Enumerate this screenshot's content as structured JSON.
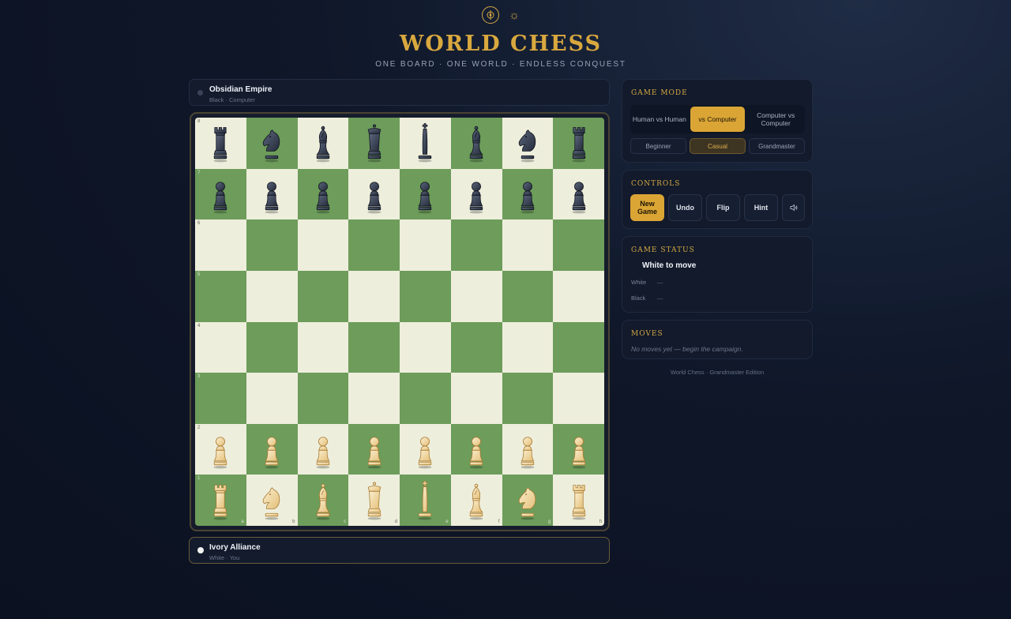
{
  "header": {
    "emblem_icon": "compass-emblem-icon",
    "theme_icon": "sun-icon",
    "title": "WORLD CHESS",
    "subtitle": "ONE BOARD · ONE WORLD · ENDLESS CONQUEST"
  },
  "players": {
    "top": {
      "name": "Obsidian Empire",
      "sub": "Black · Computer"
    },
    "bottom": {
      "name": "Ivory Alliance",
      "sub": "White · You"
    }
  },
  "board": {
    "ranks": [
      "8",
      "7",
      "6",
      "5",
      "4",
      "3",
      "2",
      "1"
    ],
    "files": [
      "a",
      "b",
      "c",
      "d",
      "e",
      "f",
      "g",
      "h"
    ],
    "position": [
      [
        "bR",
        "bN",
        "bB",
        "bQ",
        "bK",
        "bB",
        "bN",
        "bR"
      ],
      [
        "bP",
        "bP",
        "bP",
        "bP",
        "bP",
        "bP",
        "bP",
        "bP"
      ],
      [
        "",
        "",
        "",
        "",
        "",
        "",
        "",
        ""
      ],
      [
        "",
        "",
        "",
        "",
        "",
        "",
        "",
        ""
      ],
      [
        "",
        "",
        "",
        "",
        "",
        "",
        "",
        ""
      ],
      [
        "",
        "",
        "",
        "",
        "",
        "",
        "",
        ""
      ],
      [
        "wP",
        "wP",
        "wP",
        "wP",
        "wP",
        "wP",
        "wP",
        "wP"
      ],
      [
        "wR",
        "wN",
        "wB",
        "wQ",
        "wK",
        "wB",
        "wN",
        "wR"
      ]
    ],
    "colors": {
      "light": "#eeeedc",
      "dark": "#6d9c5b"
    }
  },
  "game_mode": {
    "title": "GAME MODE",
    "modes": [
      "Human vs Human",
      "vs Computer",
      "Computer vs Computer"
    ],
    "active_mode": "vs Computer",
    "difficulties": [
      "Beginner",
      "Casual",
      "Grandmaster"
    ],
    "active_difficulty": "Casual"
  },
  "controls": {
    "title": "CONTROLS",
    "new_game": "New Game",
    "undo": "Undo",
    "flip": "Flip",
    "hint": "Hint",
    "sound_icon": "speaker-icon"
  },
  "status": {
    "title": "GAME STATUS",
    "text": "White to move",
    "white_label": "White",
    "white_value": "—",
    "black_label": "Black",
    "black_value": "—"
  },
  "moves": {
    "title": "MOVES",
    "empty": "No moves yet — begin the campaign."
  },
  "footer": "World Chess · Grandmaster Edition",
  "theme": {
    "accent": "#d4a843",
    "background": "#0f1729"
  }
}
